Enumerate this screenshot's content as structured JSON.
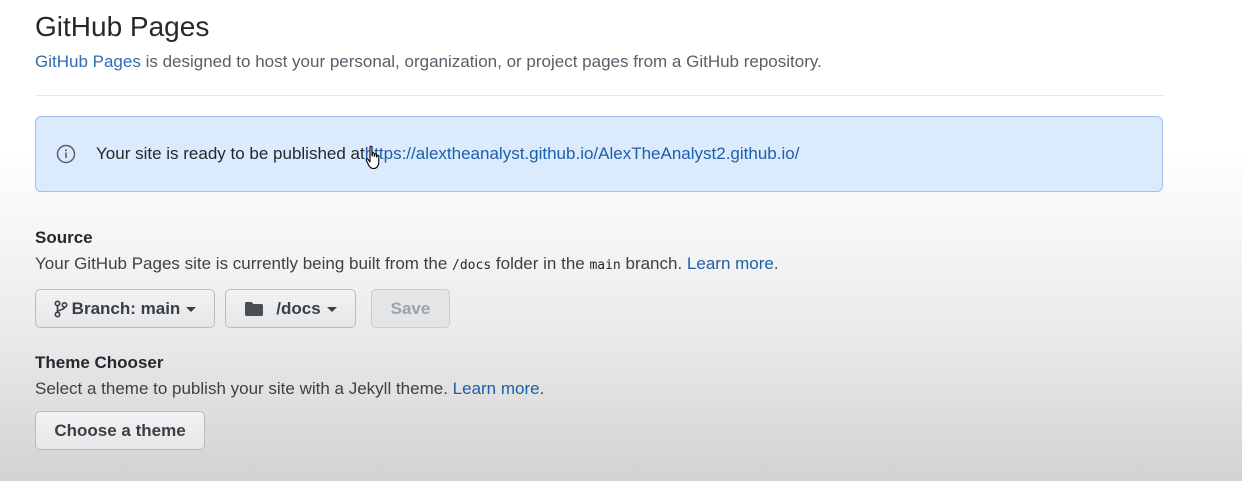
{
  "header": {
    "title": "GitHub Pages",
    "intro_link": "GitHub Pages",
    "intro_text": " is designed to host your personal, organization, or project pages from a GitHub repository."
  },
  "notice": {
    "icon": "info-icon",
    "text": "Your site is ready to be published at ",
    "url": "https://alextheanalyst.github.io/AlexTheAnalyst2.github.io/"
  },
  "source": {
    "label": "Source",
    "desc_1": "Your GitHub Pages site is currently being built from the ",
    "folder_code": "/docs",
    "desc_2": " folder in the ",
    "branch_code": "main",
    "desc_3": " branch. ",
    "learn_more": "Learn more",
    "desc_end": ".",
    "branch_button": "Branch: main",
    "folder_button": "/docs",
    "save_button": "Save"
  },
  "theme": {
    "label": "Theme Chooser",
    "desc": "Select a theme to publish your site with a Jekyll theme. ",
    "learn_more": "Learn more",
    "desc_end": ".",
    "choose_button": "Choose a theme"
  },
  "colors": {
    "link": "#0969da",
    "notice_bg": "#dbeafc",
    "notice_border": "#9cc2e8"
  }
}
